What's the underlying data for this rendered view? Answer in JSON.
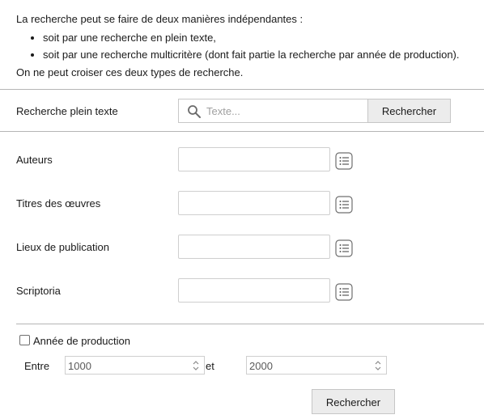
{
  "intro": {
    "line1": "La recherche peut se faire de deux manières indépendantes :",
    "bullets": [
      "soit par une recherche en plein texte,",
      "soit par une recherche multicritère (dont fait partie la recherche par année de production)."
    ],
    "line2": "On ne peut croiser ces deux types de recherche."
  },
  "fulltext": {
    "label": "Recherche plein texte",
    "placeholder": "Texte...",
    "button_label": "Rechercher"
  },
  "criteria": [
    {
      "label": "Auteurs",
      "value": ""
    },
    {
      "label": "Titres des œuvres",
      "value": ""
    },
    {
      "label": "Lieux de publication",
      "value": ""
    },
    {
      "label": "Scriptoria",
      "value": ""
    }
  ],
  "production": {
    "checkbox_label": "Année de production",
    "checked": false,
    "between_label": "Entre",
    "from_value": "1000",
    "and_label": "et",
    "to_value": "2000"
  },
  "multi_search_button": "Rechercher",
  "icons": {
    "search": "magnifier-icon",
    "list": "list-icon",
    "spinner": "spinner-icon"
  }
}
